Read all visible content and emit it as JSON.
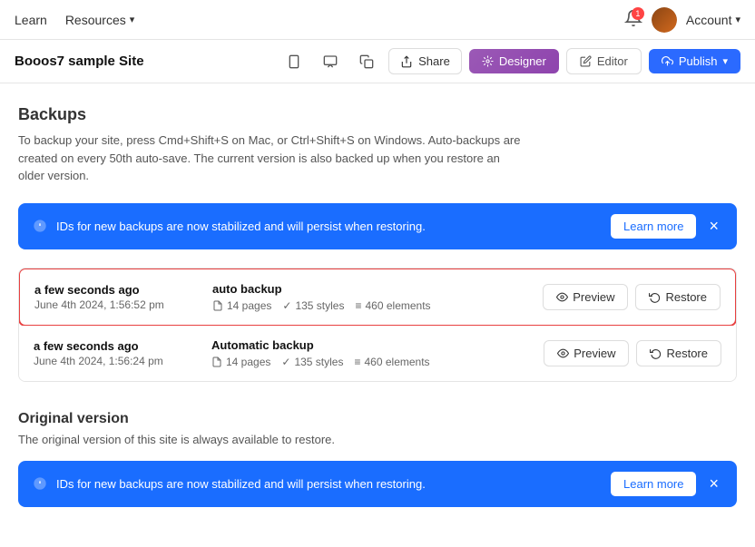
{
  "topnav": {
    "learn": "Learn",
    "resources": "Resources",
    "chevron": "▾",
    "notification_badge": "1",
    "account_label": "Account",
    "account_chevron": "▾"
  },
  "secondary_toolbar": {
    "site_name": "Booos7 sample Site",
    "share_label": "Share",
    "designer_label": "Designer",
    "editor_label": "Editor",
    "publish_label": "Publish",
    "publish_chevron": "▾"
  },
  "backups": {
    "page_title": "Backups",
    "page_desc": "To backup your site, press Cmd+Shift+S on Mac, or Ctrl+Shift+S on Windows. Auto-backups are created on every 50th auto-save. The current version is also backed up when you restore an older version.",
    "info_banner_text": "IDs for new backups are now stabilized and will persist when restoring.",
    "learn_more": "Learn more",
    "entries": [
      {
        "relative_time": "a few seconds ago",
        "absolute_time": "June 4th 2024, 1:56:52 pm",
        "name": "auto backup",
        "pages": "14 pages",
        "styles": "135 styles",
        "elements": "460 elements",
        "highlighted": true
      },
      {
        "relative_time": "a few seconds ago",
        "absolute_time": "June 4th 2024, 1:56:24 pm",
        "name": "Automatic backup",
        "pages": "14 pages",
        "styles": "135 styles",
        "elements": "460 elements",
        "highlighted": false
      }
    ],
    "preview_label": "Preview",
    "restore_label": "Restore"
  },
  "original_version": {
    "section_title": "Original version",
    "section_desc": "The original version of this site is always available to restore.",
    "info_banner_text": "IDs for new backups are now stabilized and will persist when restoring.",
    "learn_more": "Learn more"
  }
}
